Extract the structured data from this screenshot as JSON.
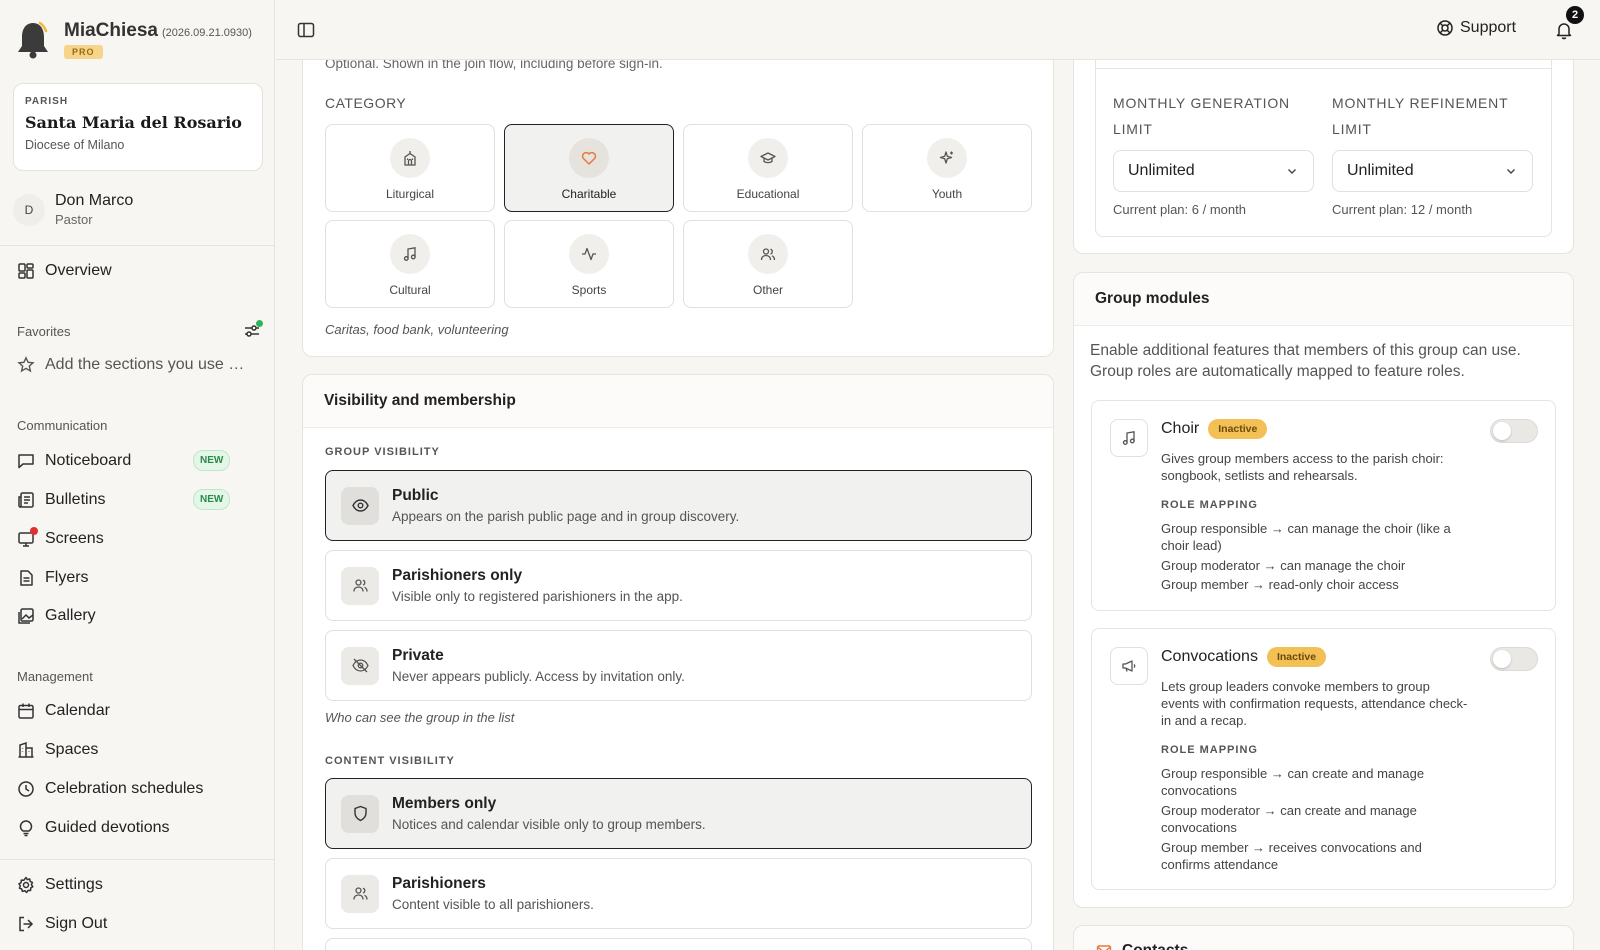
{
  "brand": {
    "name": "MiaChiesa",
    "version": "(2026.09.21.0930)",
    "badge": "PRO"
  },
  "parish": {
    "label": "PARISH",
    "name": "Santa Maria del Rosario",
    "diocese": "Diocese of Milano"
  },
  "user": {
    "initial": "D",
    "name": "Don Marco",
    "role": "Pastor"
  },
  "nav": {
    "overview": "Overview",
    "favorites_label": "Favorites",
    "favorites_add": "Add the sections you use most",
    "communication_label": "Communication",
    "noticeboard": "Noticeboard",
    "bulletins": "Bulletins",
    "new_badge": "NEW",
    "screens": "Screens",
    "flyers": "Flyers",
    "gallery": "Gallery",
    "management_label": "Management",
    "calendar": "Calendar",
    "spaces": "Spaces",
    "celebration_schedules": "Celebration schedules",
    "guided_devotions": "Guided devotions",
    "settings": "Settings",
    "sign_out": "Sign Out"
  },
  "topbar": {
    "support": "Support",
    "notifications_count": "2"
  },
  "category": {
    "optional_note": "Optional. Shown in the join flow, including before sign-in.",
    "label": "CATEGORY",
    "tiles": [
      {
        "label": "Liturgical",
        "icon": "church-icon"
      },
      {
        "label": "Charitable",
        "icon": "heart-icon",
        "selected": true
      },
      {
        "label": "Educational",
        "icon": "graduation-cap-icon"
      },
      {
        "label": "Youth",
        "icon": "sparkles-icon"
      },
      {
        "label": "Cultural",
        "icon": "music-note-icon"
      },
      {
        "label": "Sports",
        "icon": "activity-icon"
      },
      {
        "label": "Other",
        "icon": "users-icon"
      }
    ],
    "hint": "Caritas, food bank, volunteering"
  },
  "visibility": {
    "title": "Visibility and membership",
    "group_visibility_label": "GROUP VISIBILITY",
    "group_options": [
      {
        "title": "Public",
        "desc": "Appears on the parish public page and in group discovery.",
        "selected": true,
        "icon": "eye-icon"
      },
      {
        "title": "Parishioners only",
        "desc": "Visible only to registered parishioners in the app.",
        "icon": "users-icon"
      },
      {
        "title": "Private",
        "desc": "Never appears publicly. Access by invitation only.",
        "icon": "eye-off-icon"
      }
    ],
    "group_hint": "Who can see the group in the list",
    "content_visibility_label": "CONTENT VISIBILITY",
    "content_options": [
      {
        "title": "Members only",
        "desc": "Notices and calendar visible only to group members.",
        "selected": true,
        "icon": "shield-icon"
      },
      {
        "title": "Parishioners",
        "desc": "Content visible to all parishioners.",
        "icon": "users-icon"
      }
    ]
  },
  "limits": {
    "generation_label": "MONTHLY GENERATION LIMIT",
    "generation_value": "Unlimited",
    "generation_note": "Current plan: 6 / month",
    "refinement_label": "MONTHLY REFINEMENT LIMIT",
    "refinement_value": "Unlimited",
    "refinement_note": "Current plan: 12 / month"
  },
  "modules": {
    "title": "Group modules",
    "intro": "Enable additional features that members of this group can use. Group roles are automatically mapped to feature roles.",
    "role_mapping_label": "ROLE MAPPING",
    "inactive_badge": "Inactive",
    "choir": {
      "title": "Choir",
      "desc": "Gives group members access to the parish choir: songbook, setlists and rehearsals.",
      "mappings": [
        "Group responsible → can manage the choir (like a choir lead)",
        "Group moderator → can manage the choir",
        "Group member → read-only choir access"
      ]
    },
    "convocations": {
      "title": "Convocations",
      "desc": "Lets group leaders convoke members to group events with confirmation requests, attendance check-in and a recap.",
      "mappings": [
        "Group responsible → can create and manage convocations",
        "Group moderator → can create and manage convocations",
        "Group member → receives convocations and confirms attendance"
      ]
    }
  },
  "contacts": {
    "title": "Contacts"
  }
}
